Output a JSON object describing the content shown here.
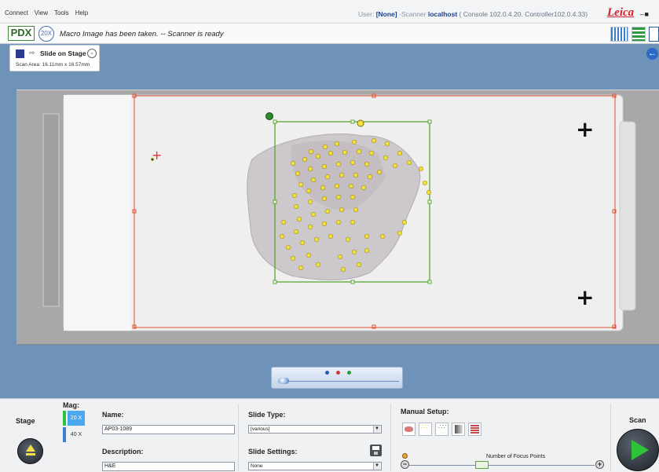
{
  "menu": {
    "items": [
      "Connect",
      "View",
      "Tools",
      "Help"
    ]
  },
  "user_info": {
    "user_label": "User:",
    "user": "[None]",
    "scanner_label": "-Scanner",
    "host": "localhost",
    "versions": "( Console 102.0.4.20.  Controller102.0.4.33)"
  },
  "brand": "Leica",
  "window_controls": "‒ ■",
  "status": {
    "pdx": "PDX",
    "mag_badge": "20X",
    "message": "Macro Image has been taken. -- Scanner is ready"
  },
  "stage_panel": {
    "title": "Slide on Stage",
    "scan_area": "Scan Area: 16.11mm x 16.57mm"
  },
  "bottom": {
    "stage_label": "Stage",
    "mag_label": "Mag:",
    "mag_options": [
      "20 X",
      "40 X"
    ],
    "mag_selected": "20 X",
    "name_label": "Name:",
    "name_value": "AP03-1089",
    "description_label": "Description:",
    "description_value": "H&E",
    "slide_type_label": "Slide Type:",
    "slide_type_value": "[various]",
    "slide_settings_label": "Slide Settings:",
    "slide_settings_value": "None",
    "manual_setup_label": "Manual Setup:",
    "focus_points_label": "Number of Focus Points",
    "scan_label": "Scan"
  },
  "colors": {
    "accent": "#2d69c7",
    "scan_area_box": "#5aa832",
    "slide_outline": "#e05030",
    "focus_point": "#f2e23a"
  }
}
